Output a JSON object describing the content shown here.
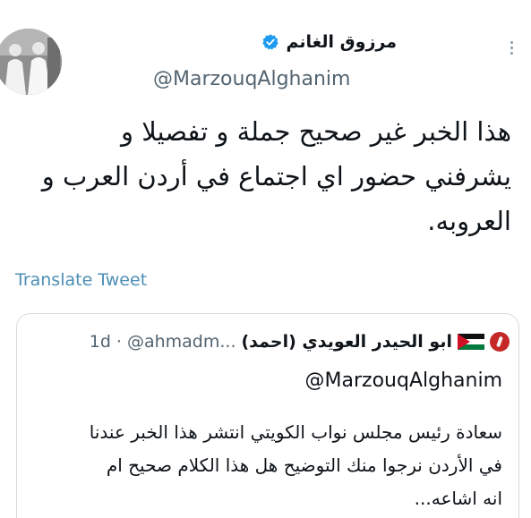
{
  "author": {
    "name": "مرزوق الغانم",
    "handle": "@MarzouqAlghanim",
    "verified_color": "#1d9bf0",
    "more_icon": "more-icon"
  },
  "tweet": {
    "lines": [
      "هذا الخبر غير صحيح جملة و تفصيلا و",
      "يشرفني حضور اي اجتماع في أردن العرب و",
      "العروبه."
    ],
    "translate_label": "Translate Tweet"
  },
  "quote": {
    "name": "ابو الحيدر العويدي (احمد)",
    "handle": "@ahmadm...",
    "time": "1d",
    "replying_to": "@MarzouqAlghanim",
    "lines": [
      "سعادة رئيس مجلس نواب الكويتي انتشر هذا الخبر عندنا",
      "في الأردن نرجوا منك التوضيح هل هذا الكلام صحيح ام",
      "انه اشاعه..."
    ]
  },
  "colors": {
    "link": "#4c8fb5",
    "muted": "#536471",
    "border": "#d6dde2"
  }
}
